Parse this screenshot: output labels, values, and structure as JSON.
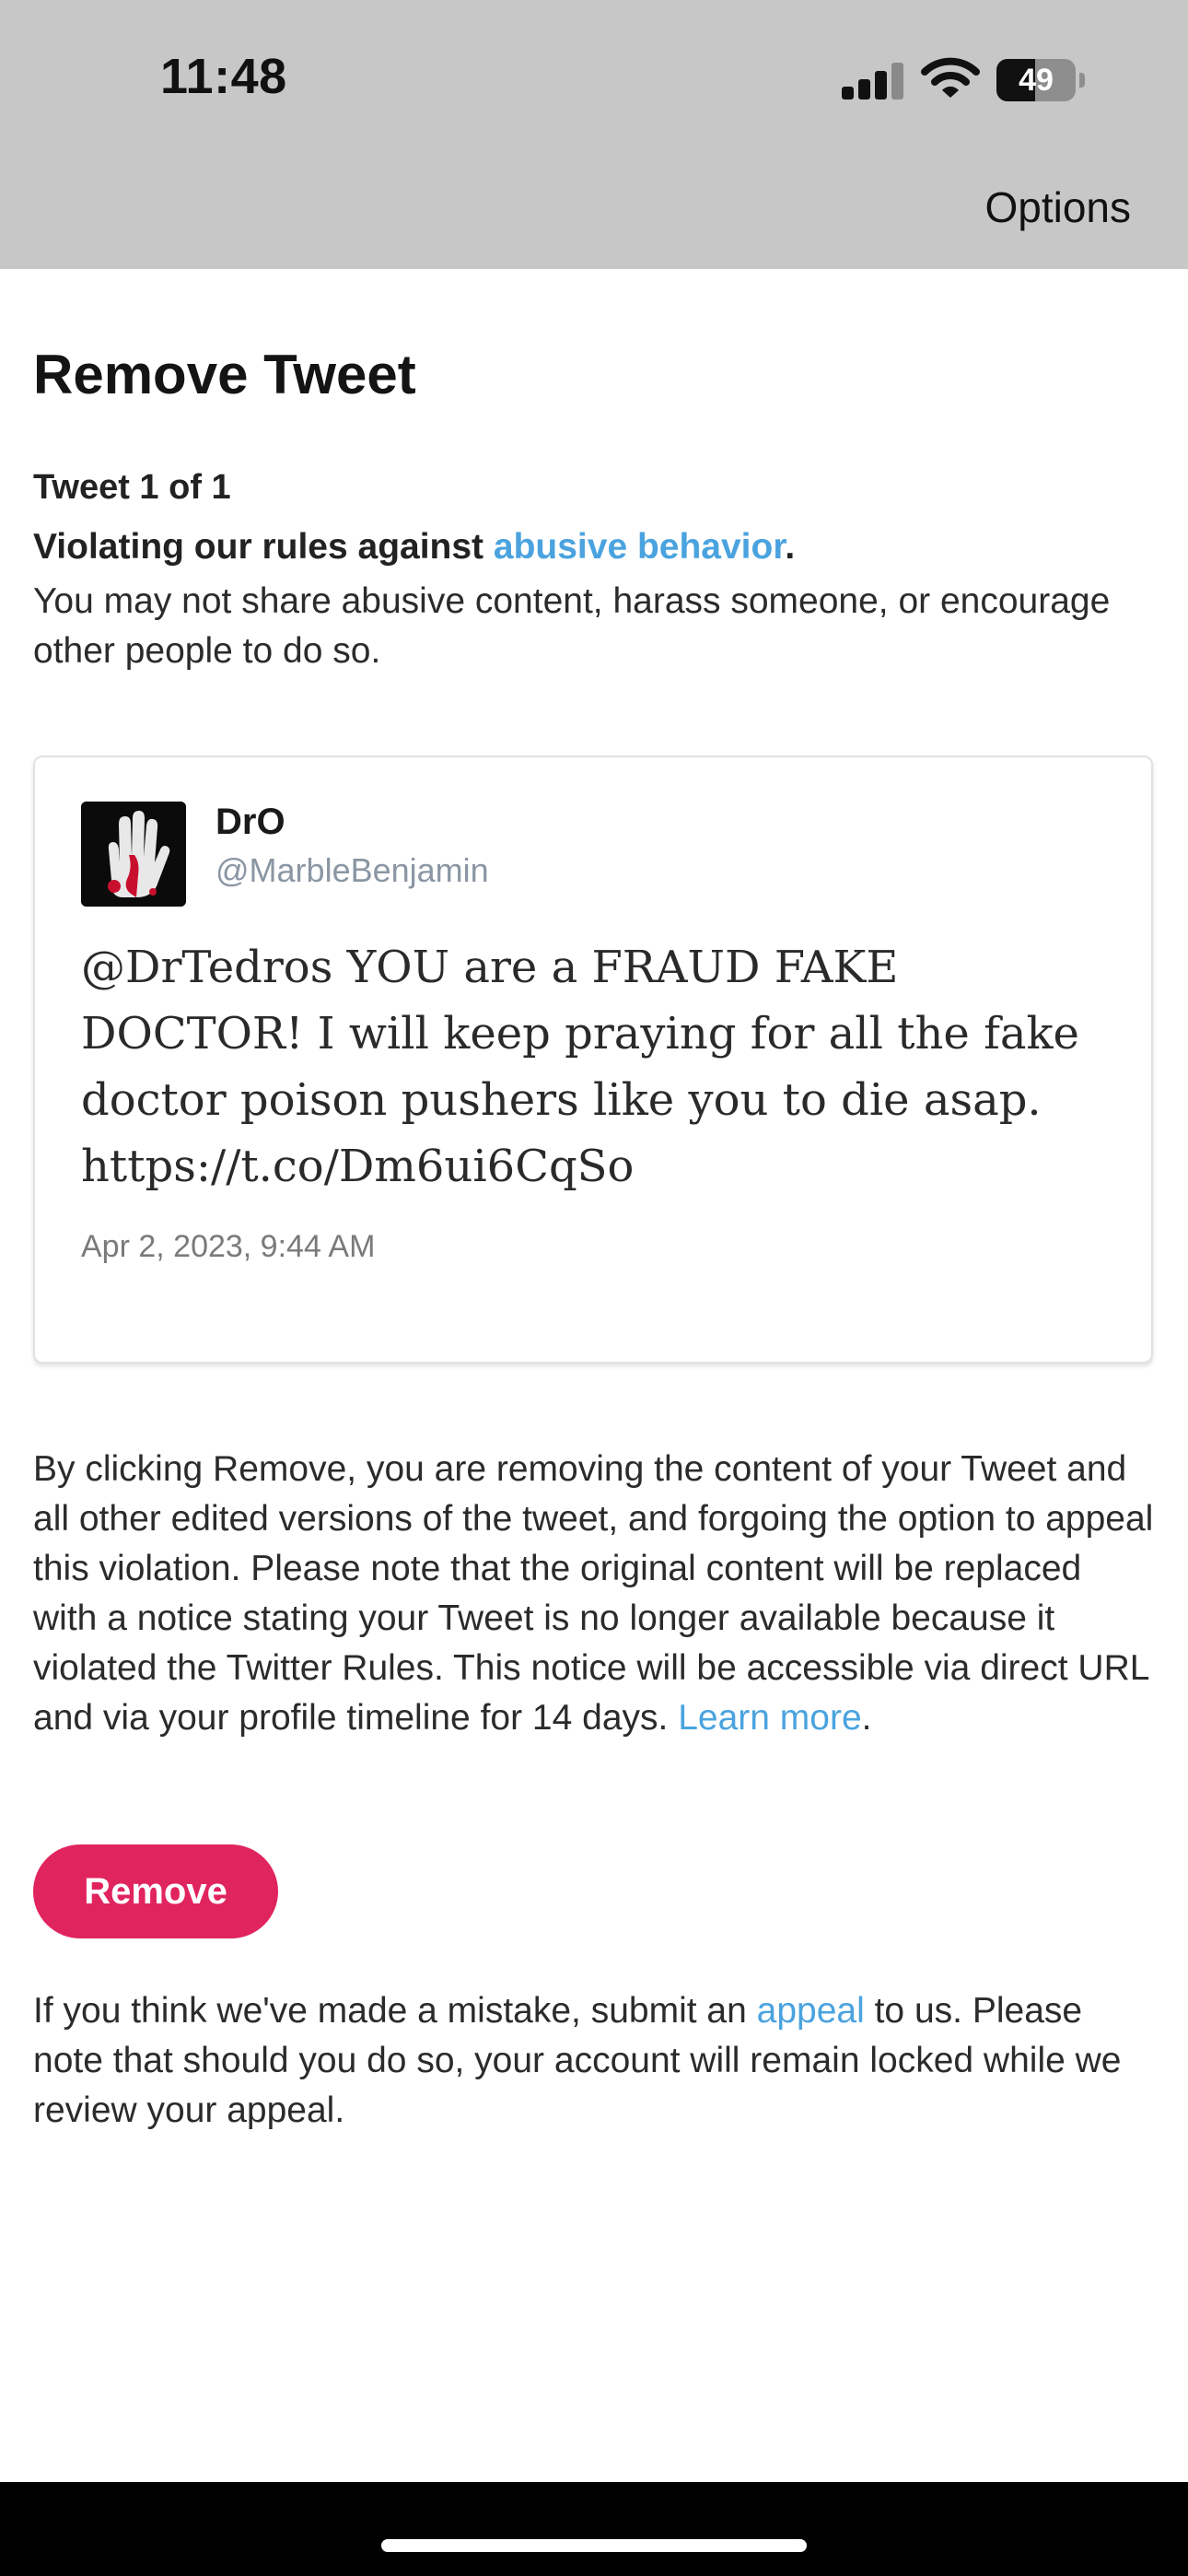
{
  "status_bar": {
    "time": "11:48",
    "battery": "49",
    "battery_level": 0.49,
    "icons": [
      "signal-icon",
      "wifi-icon",
      "battery-icon"
    ]
  },
  "header": {
    "options_label": "Options"
  },
  "main": {
    "title": "Remove Tweet",
    "tweet_count": "Tweet 1 of 1",
    "violation_prefix": "Violating our rules against ",
    "violation_link": "abusive behavior",
    "violation_suffix": ".",
    "violation_description": "You may not share abusive content, harass someone, or encourage other people to do so."
  },
  "tweet": {
    "display_name": "DrO",
    "handle": "@MarbleBenjamin",
    "text": "@DrTedros YOU are a FRAUD FAKE DOCTOR! I will keep praying for all the fake doctor poison pushers like you to die asap. https://t.co/Dm6ui6CqSo",
    "date": "Apr 2, 2023, 9:44 AM"
  },
  "remove_section": {
    "description": "By clicking Remove, you are removing the content of your Tweet and all other edited versions of the tweet, and forgoing the option to appeal this violation. Please note that the original content will be replaced with a notice stating your Tweet is no longer available because it violated the Twitter Rules. This notice will be accessible via direct URL and via your profile timeline for 14 days. ",
    "learn_more_link": "Learn more",
    "learn_more_suffix": ".",
    "button_label": "Remove"
  },
  "appeal_section": {
    "prefix": "If you think we've made a mistake, submit an ",
    "link": "appeal",
    "suffix": " to us. Please note that should you do so, your account will remain locked while we review your appeal."
  },
  "colors": {
    "link": "#4aa3df",
    "remove_button": "#e0245e",
    "top_bar": "#c7c7c7"
  }
}
